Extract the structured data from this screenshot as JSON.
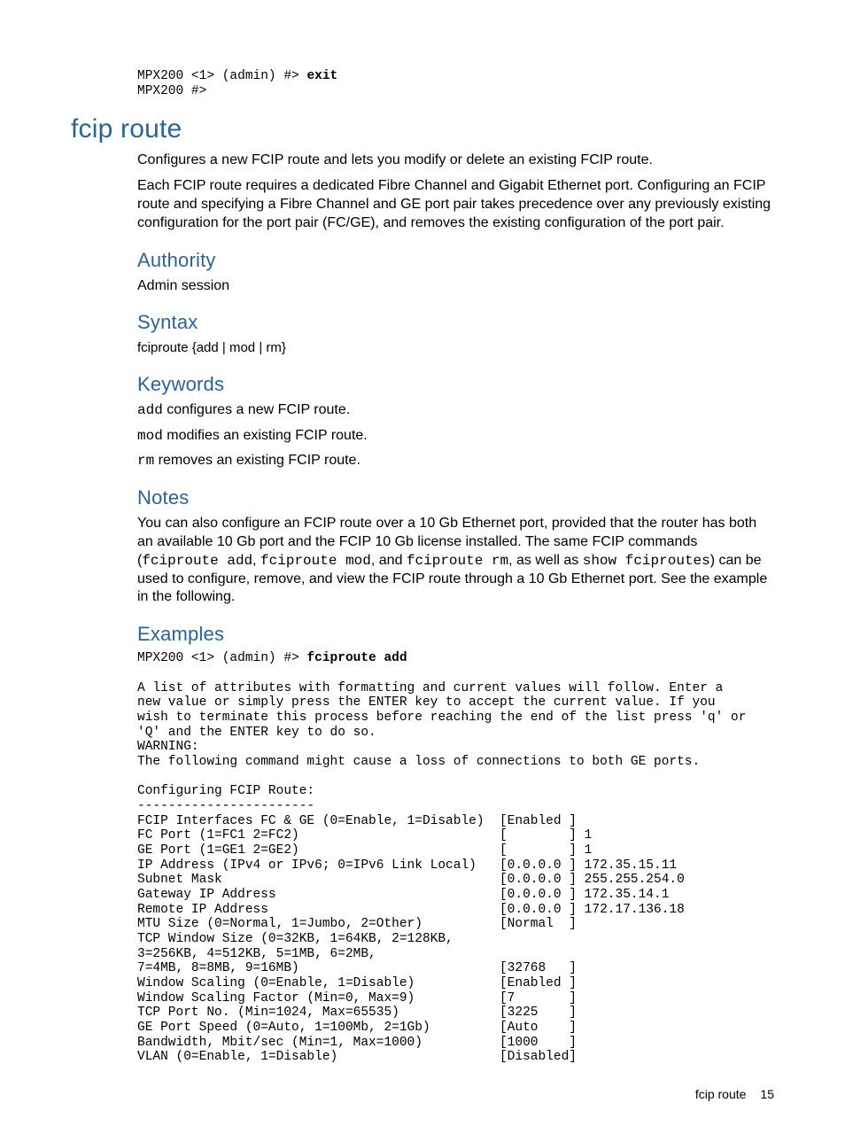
{
  "topBlock": {
    "prefix": "MPX200 <1> (admin) #> ",
    "cmd": "exit",
    "line2": "MPX200 #>"
  },
  "title": "fcip route",
  "intro1": "Configures a new FCIP route and lets you modify or delete an existing FCIP route.",
  "intro2": "Each FCIP route requires a dedicated Fibre Channel and Gigabit Ethernet port. Configuring an FCIP route and specifying a Fibre Channel and GE port pair takes precedence over any previously existing configuration for the port pair (FC/GE), and removes the existing configuration of the port pair.",
  "authority": {
    "head": "Authority",
    "body": "Admin session"
  },
  "syntax": {
    "head": "Syntax",
    "line": "fciproute {add | mod | rm}"
  },
  "keywords": {
    "head": "Keywords",
    "items": [
      {
        "kw": "add",
        "desc": " configures a new FCIP route."
      },
      {
        "kw": "mod",
        "desc": " modifies an existing FCIP route."
      },
      {
        "kw": "rm",
        "desc": " removes an existing FCIP route."
      }
    ]
  },
  "notes": {
    "head": "Notes",
    "pre": "You can also configure an FCIP route over a 10 Gb Ethernet port, provided that the router has both an available 10 Gb port and the FCIP 10 Gb license installed. The same FCIP commands (",
    "c1": "fciproute add",
    "sep1": ", ",
    "c2": "fciproute mod",
    "sep2": ", and ",
    "c3": "fciproute rm",
    "sep3": ", as well as ",
    "c4": "show fciproutes",
    "post": ") can be used to configure, remove, and view the FCIP route through a 10 Gb Ethernet port. See the example in the following."
  },
  "examples": {
    "head": "Examples",
    "promptPrefix": "MPX200 <1> (admin) #> ",
    "promptCmd": "fciproute add",
    "body": "A list of attributes with formatting and current values will follow. Enter a\nnew value or simply press the ENTER key to accept the current value. If you\nwish to terminate this process before reaching the end of the list press 'q' or\n'Q' and the ENTER key to do so.\nWARNING:\nThe following command might cause a loss of connections to both GE ports.\n\nConfiguring FCIP Route:\n-----------------------\nFCIP Interfaces FC & GE (0=Enable, 1=Disable)  [Enabled ]\nFC Port (1=FC1 2=FC2)                          [        ] 1\nGE Port (1=GE1 2=GE2)                          [        ] 1\nIP Address (IPv4 or IPv6; 0=IPv6 Link Local)   [0.0.0.0 ] 172.35.15.11\nSubnet Mask                                    [0.0.0.0 ] 255.255.254.0\nGateway IP Address                             [0.0.0.0 ] 172.35.14.1\nRemote IP Address                              [0.0.0.0 ] 172.17.136.18\nMTU Size (0=Normal, 1=Jumbo, 2=Other)          [Normal  ]\nTCP Window Size (0=32KB, 1=64KB, 2=128KB,\n3=256KB, 4=512KB, 5=1MB, 6=2MB,\n7=4MB, 8=8MB, 9=16MB)                          [32768   ]\nWindow Scaling (0=Enable, 1=Disable)           [Enabled ]\nWindow Scaling Factor (Min=0, Max=9)           [7       ]\nTCP Port No. (Min=1024, Max=65535)             [3225    ]\nGE Port Speed (0=Auto, 1=100Mb, 2=1Gb)         [Auto    ]\nBandwidth, Mbit/sec (Min=1, Max=1000)          [1000    ]\nVLAN (0=Enable, 1=Disable)                     [Disabled]"
  },
  "footer": {
    "label": "fcip route",
    "page": "15"
  }
}
